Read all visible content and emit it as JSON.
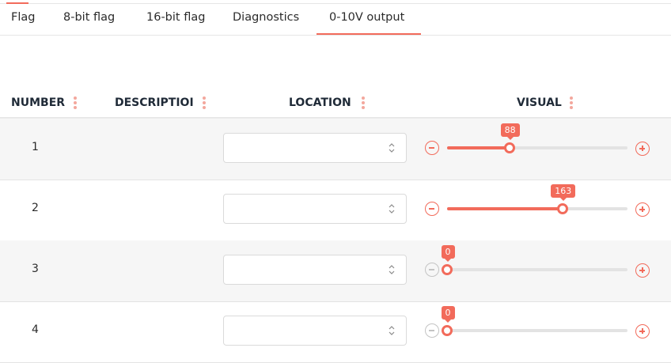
{
  "tabs": [
    {
      "label": "Flag"
    },
    {
      "label": "8-bit flag"
    },
    {
      "label": "16-bit flag"
    },
    {
      "label": "Diagnostics"
    },
    {
      "label": "0-10V output",
      "active": true
    }
  ],
  "table": {
    "columns": {
      "number": "NUMBER",
      "description": "DESCRIPTIOI",
      "location": "LOCATION",
      "visual": "VISUAL"
    },
    "rows": [
      {
        "number": "1",
        "description": "",
        "location": "",
        "value": 88,
        "value_label": "88"
      },
      {
        "number": "2",
        "description": "",
        "location": "",
        "value": 163,
        "value_label": "163"
      },
      {
        "number": "3",
        "description": "",
        "location": "",
        "value": 0,
        "value_label": "0"
      },
      {
        "number": "4",
        "description": "",
        "location": "",
        "value": 0,
        "value_label": "0"
      }
    ]
  },
  "slider": {
    "min": 0,
    "max": 255
  },
  "colors": {
    "accent": "#f26b5b",
    "disabled": "#c4c4c4",
    "track": "#e3e3e3",
    "row_shade": "#f6f6f6"
  },
  "icons": {
    "decrement": "minus-circle-icon",
    "increment": "plus-circle-icon",
    "column_menu": "vertical-dots-icon",
    "select": "up-down-chevron-icon"
  }
}
